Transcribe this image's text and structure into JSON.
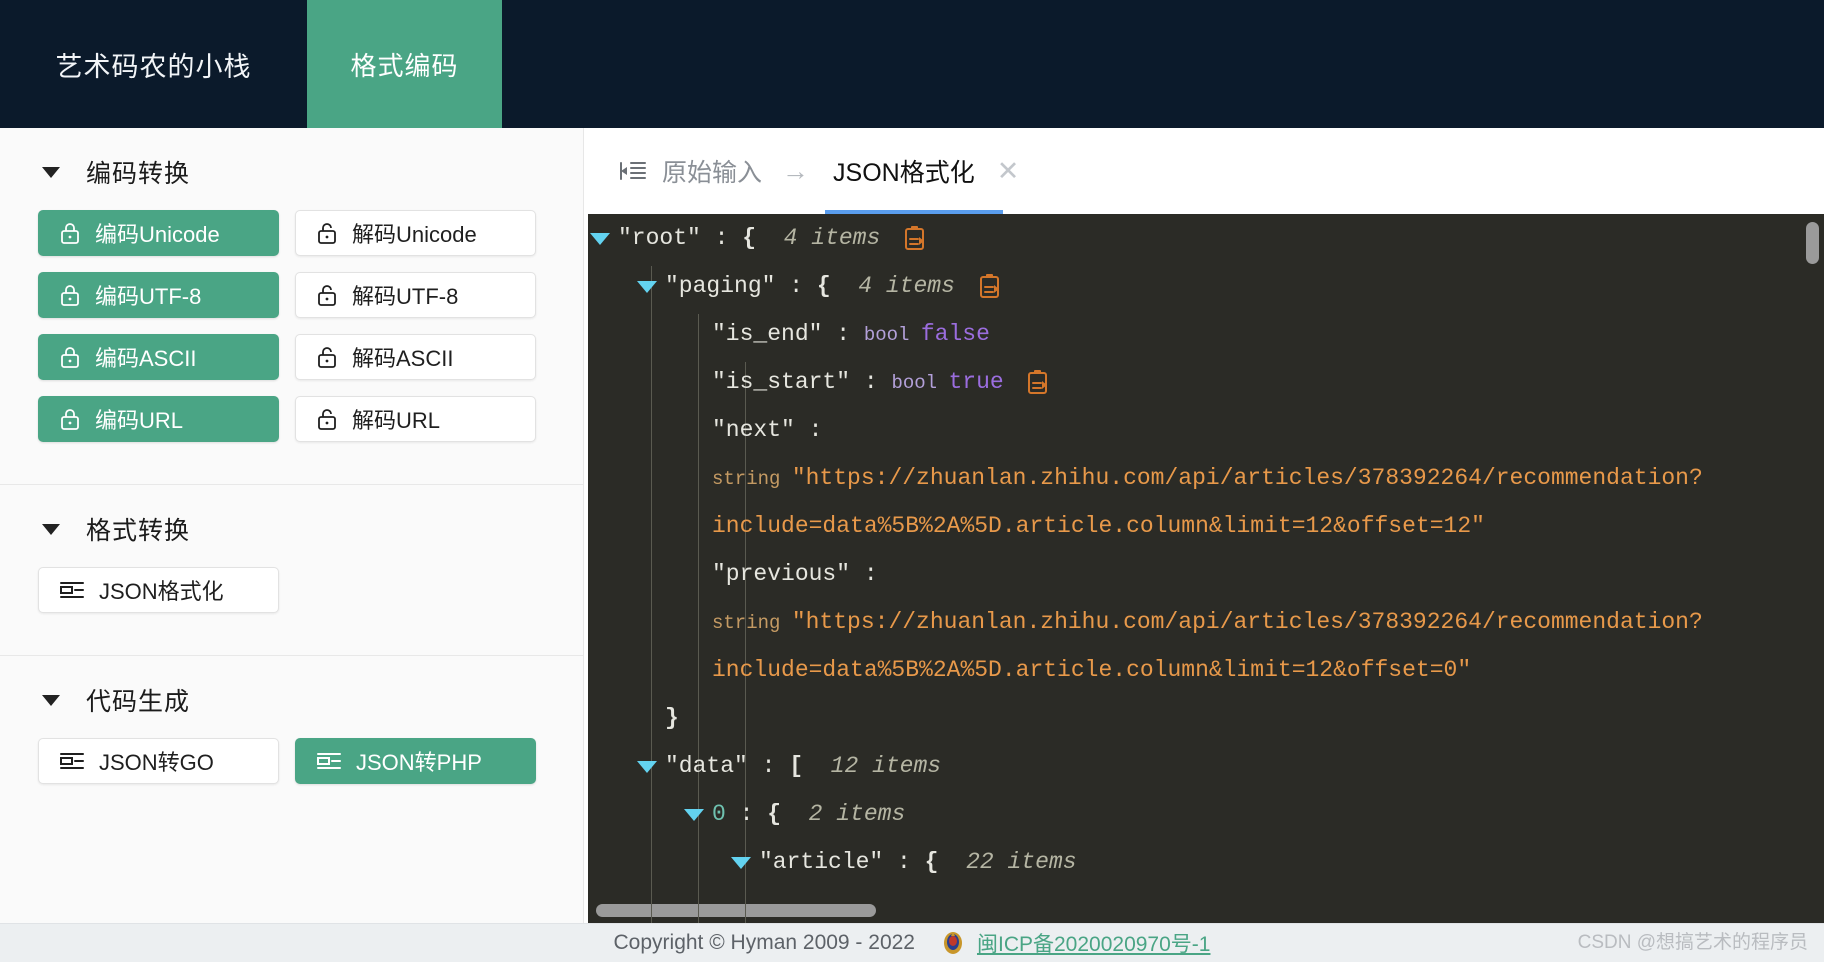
{
  "topbar": {
    "brand": "艺术码农的小栈",
    "active_tab": "格式编码"
  },
  "sidebar": {
    "sections": [
      {
        "title": "编码转换",
        "caret": "caret-down-icon",
        "rows": [
          {
            "left": {
              "label": "编码Unicode",
              "icon": "lock-closed-icon",
              "style": "green"
            },
            "right": {
              "label": "解码Unicode",
              "icon": "lock-open-icon",
              "style": "plain"
            }
          },
          {
            "left": {
              "label": "编码UTF-8",
              "icon": "lock-closed-icon",
              "style": "green"
            },
            "right": {
              "label": "解码UTF-8",
              "icon": "lock-open-icon",
              "style": "plain"
            }
          },
          {
            "left": {
              "label": "编码ASCII",
              "icon": "lock-closed-icon",
              "style": "green"
            },
            "right": {
              "label": "解码ASCII",
              "icon": "lock-open-icon",
              "style": "plain"
            }
          },
          {
            "left": {
              "label": "编码URL",
              "icon": "lock-closed-icon",
              "style": "green"
            },
            "right": {
              "label": "解码URL",
              "icon": "lock-open-icon",
              "style": "plain"
            }
          }
        ]
      },
      {
        "title": "格式转换",
        "caret": "caret-down-icon",
        "rows": [
          {
            "left": {
              "label": "JSON格式化",
              "icon": "format-lines-icon",
              "style": "plain"
            }
          }
        ]
      },
      {
        "title": "代码生成",
        "caret": "caret-down-icon",
        "rows": [
          {
            "left": {
              "label": "JSON转GO",
              "icon": "format-lines-icon",
              "style": "plain"
            },
            "right": {
              "label": "JSON转PHP",
              "icon": "format-lines-icon",
              "style": "green"
            }
          }
        ]
      }
    ]
  },
  "main": {
    "tabs": {
      "input_tab": "原始输入",
      "input_icon": "indent-lines-icon",
      "separator": "→",
      "active_tab": "JSON格式化",
      "close": "✕"
    },
    "colors": {
      "accent_green": "#4aa585",
      "tab_underline": "#5a9ded",
      "editor_bg": "#2b2b26",
      "string": "#e8994a",
      "bool": "#9b6dde",
      "key": "#e6e6df",
      "count": "#b5b5a3",
      "index": "#6fc2b0",
      "triangle": "#63d3f0",
      "copy_icon": "#d4762a"
    },
    "json_rows": [
      {
        "indent": 0,
        "tri": true,
        "copy": true,
        "segments": [
          {
            "t": "\"root\"",
            "c": "key"
          },
          {
            "t": " : ",
            "c": "key"
          },
          {
            "t": "{",
            "c": "punct"
          },
          {
            "t": "  4 items ",
            "c": "count"
          }
        ]
      },
      {
        "indent": 1,
        "tri": true,
        "copy": true,
        "segments": [
          {
            "t": "\"paging\"",
            "c": "key"
          },
          {
            "t": " : ",
            "c": "key"
          },
          {
            "t": "{",
            "c": "punct"
          },
          {
            "t": "  4 items ",
            "c": "count"
          }
        ]
      },
      {
        "indent": 2,
        "tri": false,
        "copy": false,
        "segments": [
          {
            "t": "\"is_end\"",
            "c": "key"
          },
          {
            "t": " : ",
            "c": "key"
          },
          {
            "t": "bool ",
            "c": "type"
          },
          {
            "t": "false",
            "c": "bool"
          }
        ]
      },
      {
        "indent": 2,
        "tri": false,
        "copy": true,
        "segments": [
          {
            "t": "\"is_start\"",
            "c": "key"
          },
          {
            "t": " : ",
            "c": "key"
          },
          {
            "t": "bool ",
            "c": "type"
          },
          {
            "t": "true ",
            "c": "bool"
          }
        ]
      },
      {
        "indent": 2,
        "tri": false,
        "copy": false,
        "segments": [
          {
            "t": "\"next\"",
            "c": "key"
          },
          {
            "t": " :",
            "c": "key"
          }
        ]
      },
      {
        "indent": 2,
        "tri": false,
        "copy": false,
        "segments": [
          {
            "t": "string ",
            "c": "strtype"
          },
          {
            "t": "\"https://zhuanlan.zhihu.com/api/articles/378392264/recommendation?",
            "c": "str"
          }
        ]
      },
      {
        "indent": 2,
        "tri": false,
        "copy": false,
        "segments": [
          {
            "t": "include=data%5B%2A%5D.article.column&limit=12&offset=12\"",
            "c": "str"
          }
        ]
      },
      {
        "indent": 2,
        "tri": false,
        "copy": false,
        "segments": [
          {
            "t": "\"previous\"",
            "c": "key"
          },
          {
            "t": " :",
            "c": "key"
          }
        ]
      },
      {
        "indent": 2,
        "tri": false,
        "copy": false,
        "segments": [
          {
            "t": "string ",
            "c": "strtype"
          },
          {
            "t": "\"https://zhuanlan.zhihu.com/api/articles/378392264/recommendation?",
            "c": "str"
          }
        ]
      },
      {
        "indent": 2,
        "tri": false,
        "copy": false,
        "segments": [
          {
            "t": "include=data%5B%2A%5D.article.column&limit=12&offset=0\"",
            "c": "str"
          }
        ]
      },
      {
        "indent": 1,
        "tri": false,
        "copy": false,
        "segments": [
          {
            "t": "}",
            "c": "punct"
          }
        ]
      },
      {
        "indent": 1,
        "tri": true,
        "copy": false,
        "segments": [
          {
            "t": "\"data\"",
            "c": "key"
          },
          {
            "t": " : ",
            "c": "key"
          },
          {
            "t": "[",
            "c": "punct"
          },
          {
            "t": "  12 items",
            "c": "count"
          }
        ]
      },
      {
        "indent": 2,
        "tri": true,
        "copy": false,
        "segments": [
          {
            "t": "0",
            "c": "idx"
          },
          {
            "t": " : ",
            "c": "key"
          },
          {
            "t": "{",
            "c": "punct"
          },
          {
            "t": "  2 items",
            "c": "count"
          }
        ]
      },
      {
        "indent": 3,
        "tri": true,
        "copy": false,
        "segments": [
          {
            "t": "\"article\"",
            "c": "key"
          },
          {
            "t": " : ",
            "c": "key"
          },
          {
            "t": "{",
            "c": "punct"
          },
          {
            "t": "  22 items",
            "c": "count"
          }
        ]
      }
    ]
  },
  "footer": {
    "copyright": "Copyright © Hyman 2009 - 2022",
    "police_icon": "police-badge-icon",
    "beian": "闽ICP备2020020970号-1",
    "watermark": "CSDN @想搞艺术的程序员"
  }
}
